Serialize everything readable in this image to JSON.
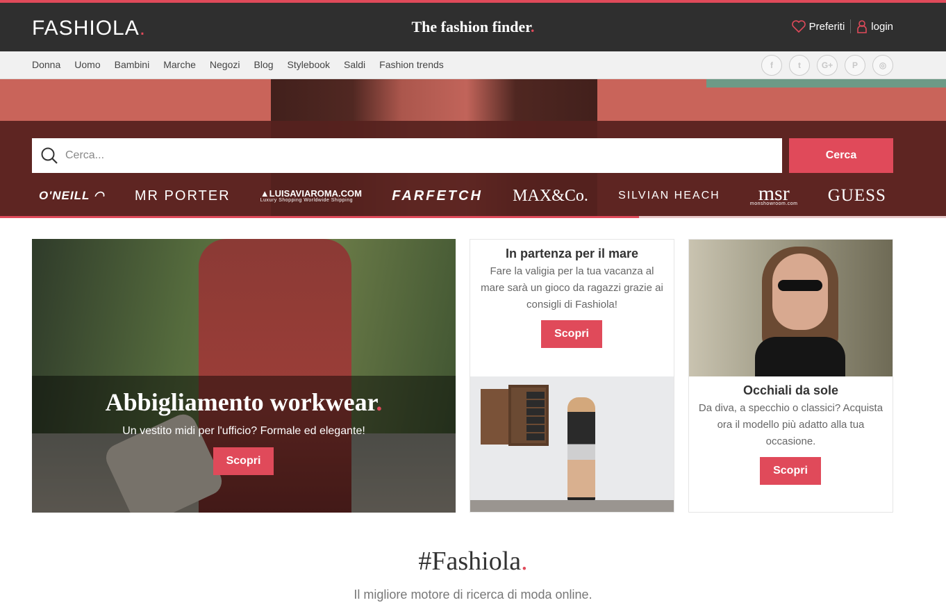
{
  "header": {
    "logo": "FASHIOLA",
    "logo_dot": ".",
    "tagline": "The fashion finder",
    "tagline_dot": ".",
    "favorites_label": "Preferiti",
    "login_label": "login"
  },
  "nav": {
    "items": [
      "Donna",
      "Uomo",
      "Bambini",
      "Marche",
      "Negozi",
      "Blog",
      "Stylebook",
      "Saldi",
      "Fashion trends"
    ],
    "social": [
      "f",
      "t",
      "G+",
      "P",
      "◎"
    ]
  },
  "search": {
    "placeholder": "Cerca...",
    "button_label": "Cerca"
  },
  "brands": {
    "oneill": "O'NEILL",
    "mrporter": "MR PORTER",
    "luisaviaroma": "▲LUISAVIAROMA.COM",
    "luisaviaroma_sub": "Luxury Shopping Worldwide Shipping",
    "farfetch": "FARFETCH",
    "maxco": "MAX&Co.",
    "silvianheach": "SILVIAN HEACH",
    "msr": "msr",
    "msr_sub": "monshowroom.com",
    "guess": "GUESS"
  },
  "cards": {
    "workwear": {
      "title": "Abbigliamento workwear",
      "title_dot": ".",
      "subtitle": "Un vestito midi per l'ufficio? Formale ed elegante!",
      "button": "Scopri"
    },
    "mare": {
      "title": "In partenza per il mare",
      "text": "Fare la valigia per la tua vacanza al mare sarà un gioco da ragazzi grazie ai consigli di Fashiola!",
      "button": "Scopri"
    },
    "occhiali": {
      "title": "Occhiali da sole",
      "text": "Da diva, a specchio o classici? Acquista ora il modello più adatto alla tua occasione.",
      "button": "Scopri"
    }
  },
  "footer": {
    "hashtag": "#Fashiola",
    "hashtag_dot": ".",
    "tagline": "Il migliore motore di ricerca di moda online."
  },
  "colors": {
    "accent": "#e04a5a",
    "header_bg": "#2f2f2f",
    "nav_bg": "#f1f1f1"
  }
}
